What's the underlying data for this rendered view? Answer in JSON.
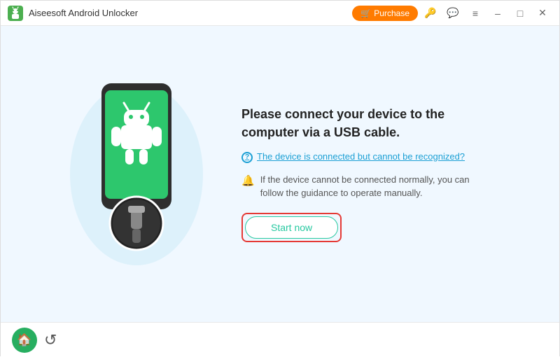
{
  "titlebar": {
    "app_name": "Aiseesoft Android Unlocker",
    "purchase_label": "Purchase"
  },
  "main": {
    "heading": "Please connect your device to the computer via a USB cable.",
    "device_link_text": "The device is connected but cannot be recognized?",
    "guidance_text": "If the device cannot be connected normally, you can follow the guidance to operate manually.",
    "start_now_label": "Start now"
  },
  "footer": {
    "home_icon": "🏠",
    "back_icon": "↺"
  },
  "icons": {
    "purchase_cart": "🛒",
    "question_mark": "?",
    "bell": "🔔",
    "key": "🔑",
    "chat": "💬",
    "menu": "≡",
    "minimize": "–",
    "maximize": "□",
    "close": "✕"
  }
}
